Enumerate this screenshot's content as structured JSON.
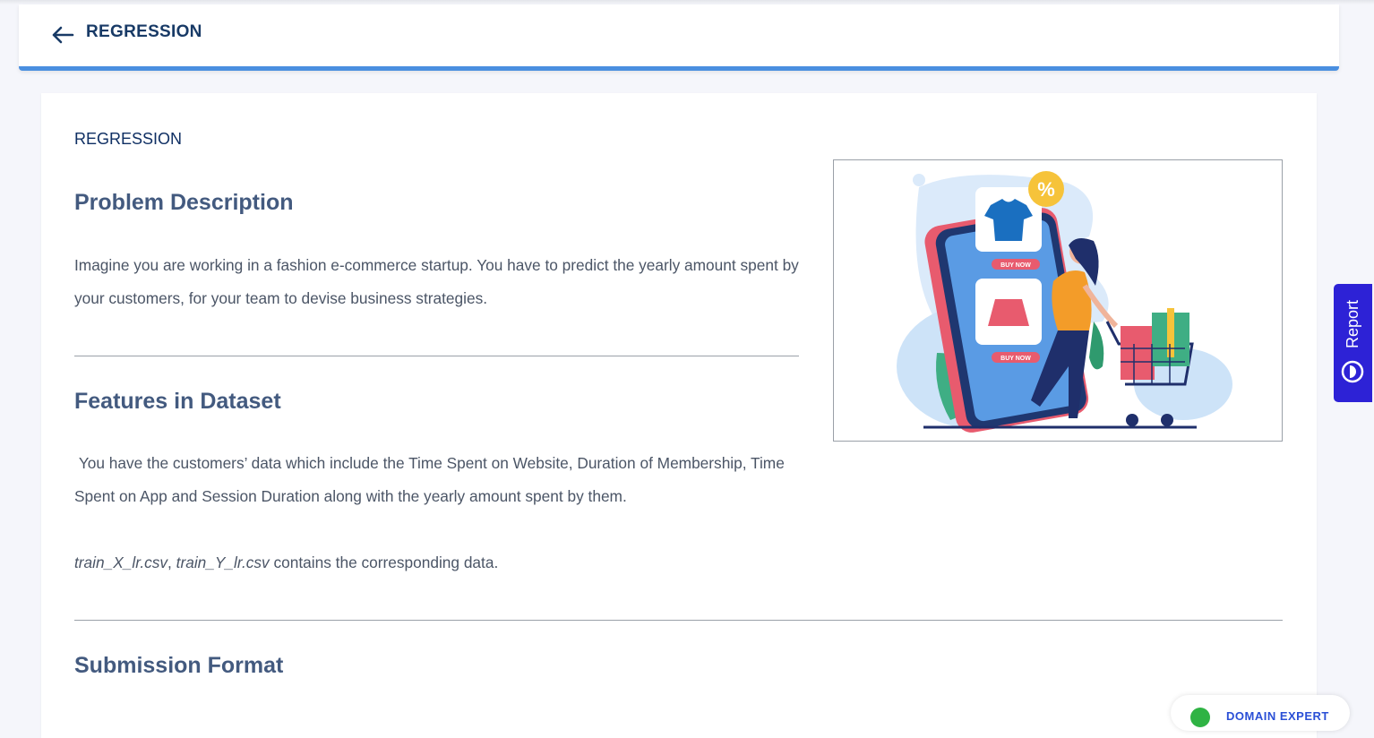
{
  "header": {
    "title": "REGRESSION"
  },
  "content": {
    "section_label": "REGRESSION",
    "problem": {
      "heading": "Problem Description",
      "text": "Imagine you are working in a fashion e-commerce startup. You have to predict the yearly amount spent by your customers, for your team to devise business strategies."
    },
    "features": {
      "heading": "Features in Dataset",
      "text": " You have the customers’ data which include the Time Spent on Website, Duration of Membership, Time Spent on App and Session Duration along with the yearly amount spent by them.",
      "file1": "train_X_lr.csv",
      "sep": ", ",
      "file2": "train_Y_lr.csv",
      "files_suffix": " contains the corresponding data."
    },
    "submission": {
      "heading": "Submission Format"
    }
  },
  "illustration": {
    "percent": "%",
    "buy_now_1": "BUY NOW",
    "buy_now_2": "BUY NOW"
  },
  "report_tab": {
    "label": "Report"
  },
  "domain_button": {
    "label": "DOMAIN EXPERT"
  },
  "colors": {
    "accent": "#4a8fe0",
    "title_navy": "#183a66",
    "heading_slate": "#435a7f",
    "report_purple": "#2d22d6"
  },
  "icons": {
    "back": "arrow-left-icon",
    "report": "report-icon",
    "domain": "whatsapp-icon"
  }
}
